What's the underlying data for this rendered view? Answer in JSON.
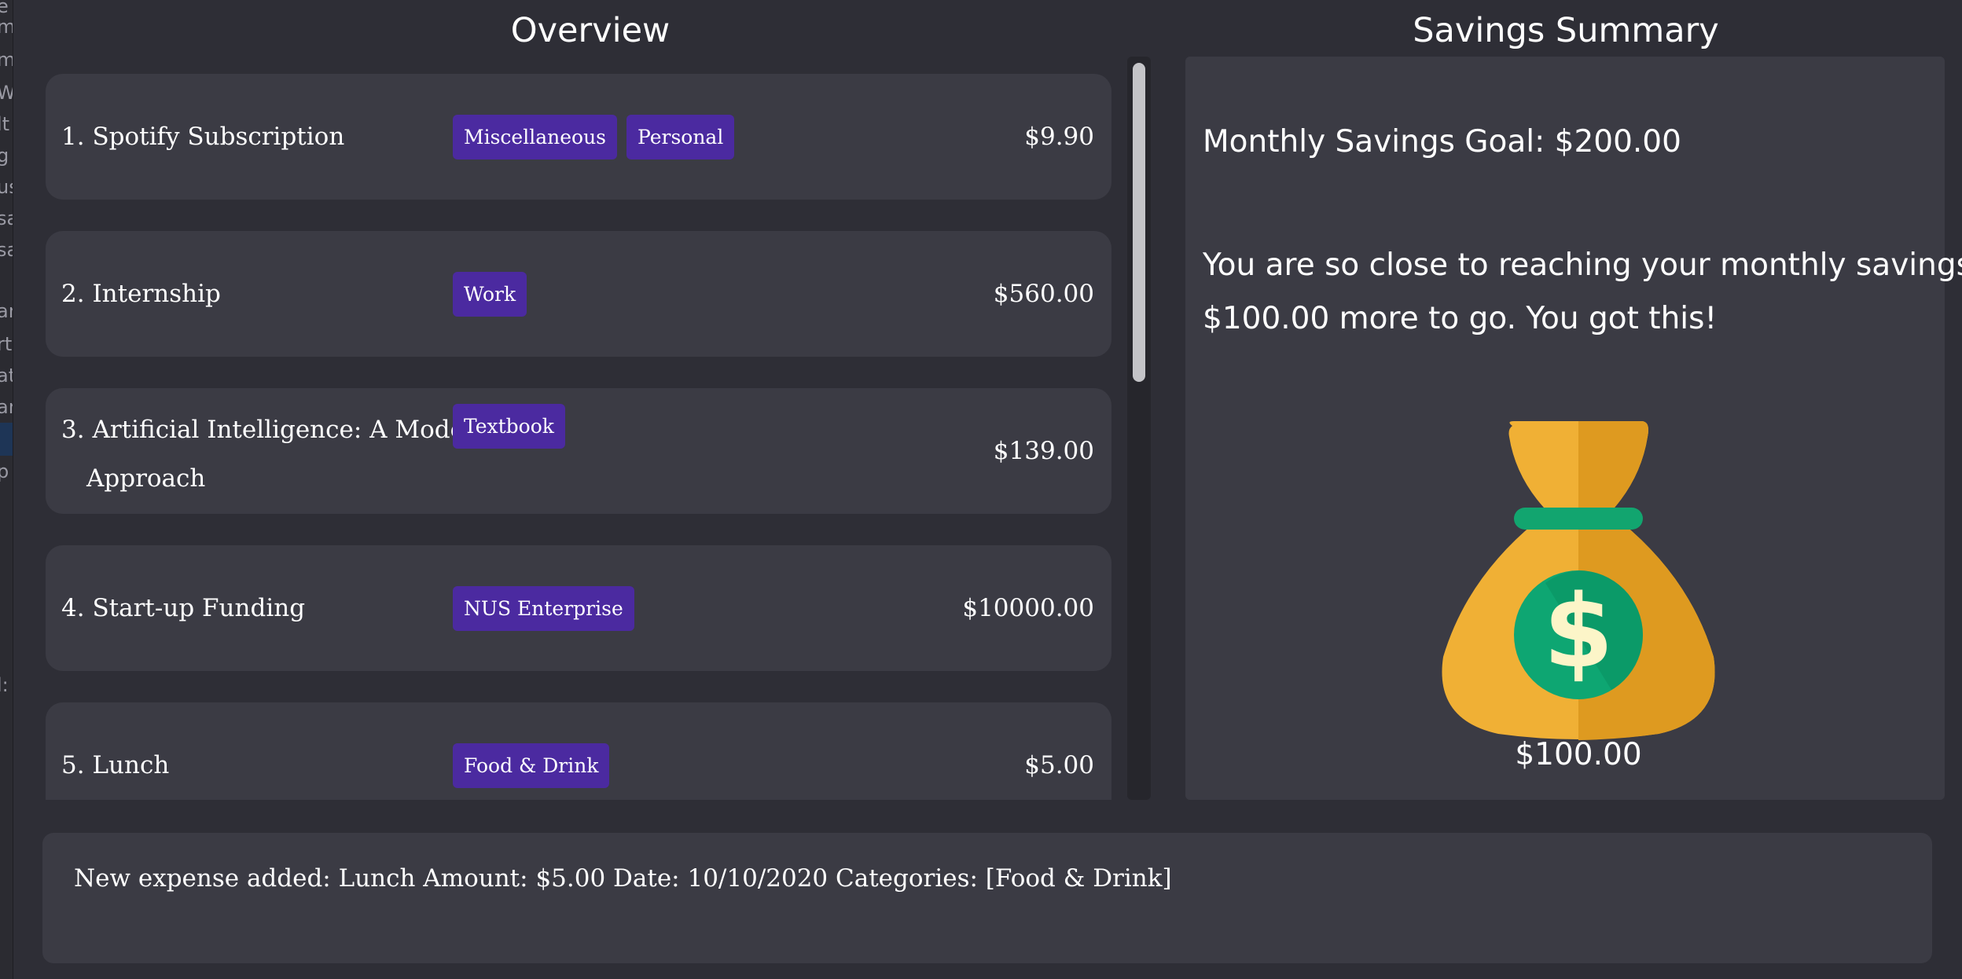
{
  "left_strip": {
    "fragments": [
      "e",
      "m",
      "m",
      "W",
      "lt",
      "g",
      "us",
      "sa",
      "sa",
      "an",
      "rt",
      "at",
      "ar",
      "p",
      "l:"
    ]
  },
  "overview": {
    "title": "Overview",
    "expenses": [
      {
        "index": "1.",
        "description": "Spotify Subscription",
        "tags": [
          "Miscellaneous",
          "Personal"
        ],
        "amount": "$9.90"
      },
      {
        "index": "2.",
        "description": "Internship",
        "tags": [
          "Work"
        ],
        "amount": "$560.00"
      },
      {
        "index": "3.",
        "description_line1": "Artificial Intelligence: A Modern",
        "description_line2": "Approach",
        "tags": [
          "Textbook"
        ],
        "amount": "$139.00"
      },
      {
        "index": "4.",
        "description": "Start-up Funding",
        "tags": [
          "NUS Enterprise"
        ],
        "amount": "$10000.00"
      },
      {
        "index": "5.",
        "description": "Lunch",
        "tags": [
          "Food & Drink"
        ],
        "amount": "$5.00"
      }
    ]
  },
  "savings": {
    "title": "Savings Summary",
    "goal_text": "Monthly Savings Goal: $200.00",
    "encourage_line1": "You are so close to reaching your monthly savings goal!",
    "encourage_line2": "$100.00 more to go. You got this!",
    "saved_amount": "$100.00",
    "icon": "money-bag-icon",
    "colors": {
      "bag": "#f0b035",
      "bag_shade": "#de9a20",
      "tie": "#12a56f",
      "coin": "#0ea672",
      "dollar": "#fcf5c8"
    }
  },
  "result_box": {
    "message": "New expense added: Lunch Amount: $5.00 Date: 10/10/2020 Categories: [Food & Drink]"
  },
  "theme": {
    "background": "#2e2e36",
    "card": "#3b3b44",
    "tag": "#4b2aa0",
    "text": "#ffffff"
  }
}
